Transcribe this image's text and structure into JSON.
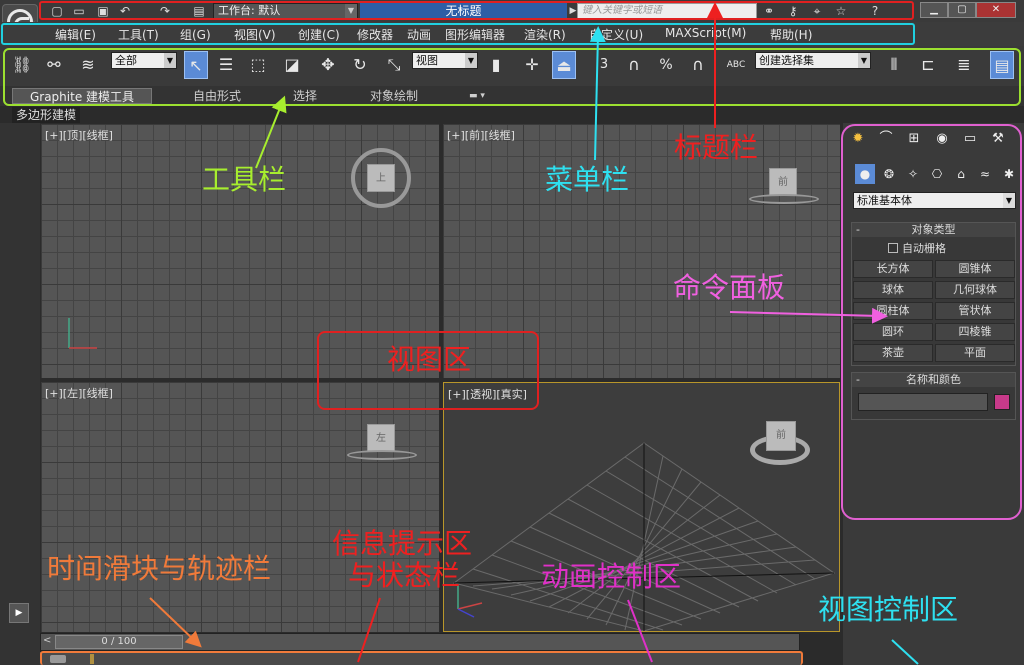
{
  "title_bar": {
    "workspace_label": "工作台: 默认",
    "document_title": "无标题",
    "search_placeholder": "键入关键字或短语"
  },
  "menu": {
    "items": [
      "编辑(E)",
      "工具(T)",
      "组(G)",
      "视图(V)",
      "创建(C)",
      "修改器",
      "动画",
      "图形编辑器",
      "渲染(R)",
      "自定义(U)",
      "MAXScript(M)",
      "帮助(H)"
    ]
  },
  "toolbar": {
    "selection_filter": "全部",
    "reference_coord": "视图",
    "named_selection": "创建选择集",
    "percent_symbol": "%",
    "angle_snap_value": "3",
    "abc_label": "ABC"
  },
  "ribbon": {
    "tabs": [
      "Graphite 建模工具",
      "自由形式",
      "选择",
      "对象绘制"
    ],
    "subtab": "多边形建模"
  },
  "viewports": {
    "top_left": {
      "label": "[+][顶][线框]",
      "cube_face": "上"
    },
    "top_right": {
      "label": "[+][前][线框]",
      "cube_face": "前"
    },
    "bottom_left": {
      "label": "[+][左][线框]",
      "cube_face": "左"
    },
    "bottom_right": {
      "label": "[+][透视][真实]",
      "cube_face": "前"
    }
  },
  "command_panel": {
    "category": "标准基本体",
    "object_type_title": "对象类型",
    "autogrid_label": "自动栅格",
    "objects": [
      "长方体",
      "圆锥体",
      "球体",
      "几何球体",
      "圆柱体",
      "管状体",
      "圆环",
      "四棱锥",
      "茶壶",
      "平面"
    ],
    "name_color_title": "名称和颜色",
    "object_color": "#c83a8a"
  },
  "timeline": {
    "frame_readout": "0 / 100",
    "prev_arrow": "<"
  },
  "annotations": {
    "title_bar": "标题栏",
    "toolbar": "工具栏",
    "menu_bar": "菜单栏",
    "command_panel": "命令面板",
    "viewport_area": "视图区",
    "time_slider": "时间滑块与轨迹栏",
    "info_status_1": "信息提示区",
    "info_status_2": "与状态栏",
    "anim_control": "动画控制区",
    "view_control": "视图控制区"
  },
  "colors": {
    "title_frame": "#e02020",
    "menu_frame": "#20d0e0",
    "toolbar_frame": "#9ce030",
    "command_frame": "#e060d0",
    "viewport_frame": "#e02020",
    "timeline_frame": "#f07a3a",
    "anno_toolbar": "#a7ee2e",
    "anno_menu": "#2ee0f0",
    "anno_title": "#ee2020",
    "anno_command": "#f060e0",
    "anno_viewport": "#ee2020",
    "anno_time": "#f07a3a",
    "anno_info": "#ee2020",
    "anno_anim": "#e030c8",
    "anno_view": "#2ee0f0"
  }
}
